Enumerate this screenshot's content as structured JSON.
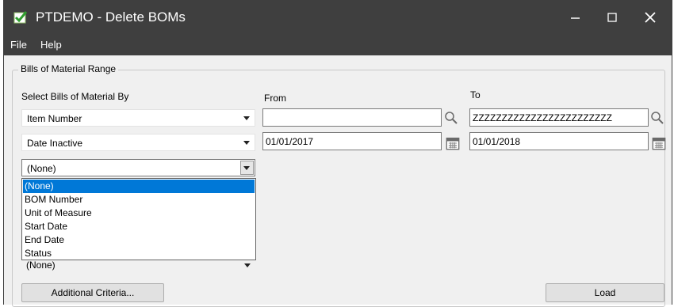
{
  "window": {
    "title": "PTDEMO - Delete BOMs",
    "icons": {
      "app": "sage-check-icon",
      "minimize": "minimize-icon",
      "maximize": "maximize-icon",
      "close": "close-icon"
    },
    "colors": {
      "titlebar": "#3f3f3f",
      "selection": "#0078d7"
    }
  },
  "menu": {
    "items": [
      "File",
      "Help"
    ]
  },
  "group": {
    "legend": "Bills of Material Range",
    "select_by_label": "Select Bills of Material By",
    "from_label": "From",
    "to_label": "To"
  },
  "rows": [
    {
      "field": "Item Number",
      "from": "",
      "to": "ZZZZZZZZZZZZZZZZZZZZZZZZ",
      "icon": "search-icon"
    },
    {
      "field": "Date Inactive",
      "from": "01/01/2017",
      "to": "01/01/2018",
      "icon": "calendar-icon"
    },
    {
      "field": "(None)"
    }
  ],
  "hidden_row": {
    "field": "(None)"
  },
  "dropdown": {
    "selected": "(None)",
    "options": [
      "(None)",
      "BOM Number",
      "Unit of Measure",
      "Start Date",
      "End Date",
      "Status"
    ]
  },
  "buttons": {
    "additional_criteria": "Additional Criteria...",
    "load": "Load"
  }
}
